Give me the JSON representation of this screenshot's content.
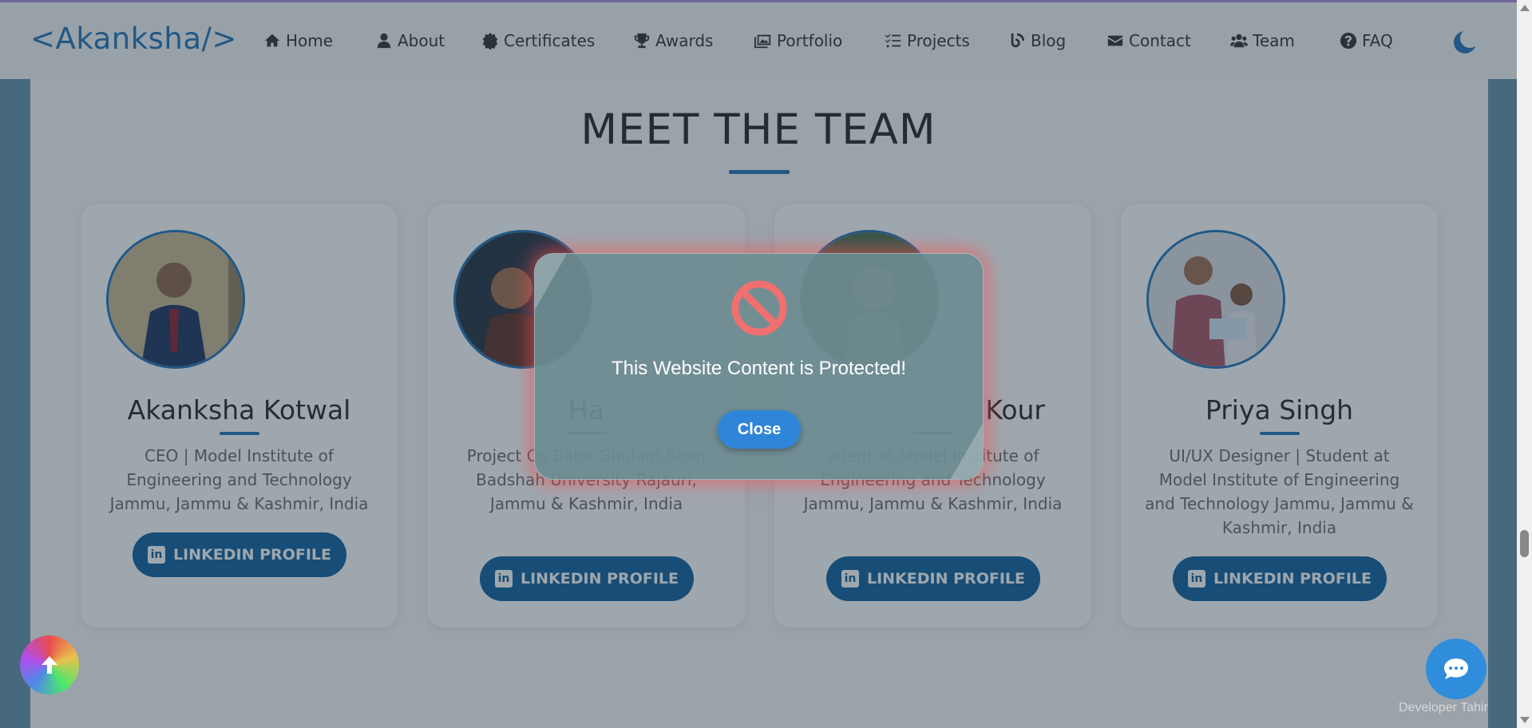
{
  "brand": {
    "logo": "<Akanksha/>"
  },
  "nav": {
    "items": [
      {
        "label": "Home",
        "icon": "home-icon"
      },
      {
        "label": "About",
        "icon": "user-icon"
      },
      {
        "label": "Certificates",
        "icon": "certificate-icon"
      },
      {
        "label": "Awards",
        "icon": "trophy-icon"
      },
      {
        "label": "Portfolio",
        "icon": "images-icon"
      },
      {
        "label": "Projects",
        "icon": "list-check-icon"
      },
      {
        "label": "Blog",
        "icon": "blog-icon"
      },
      {
        "label": "Contact",
        "icon": "envelope-icon"
      },
      {
        "label": "Team",
        "icon": "users-icon"
      },
      {
        "label": "FAQ",
        "icon": "question-circle-icon"
      }
    ],
    "theme_toggle_icon": "moon-icon"
  },
  "section": {
    "title": "MEET THE TEAM"
  },
  "team": [
    {
      "name": "Akanksha Kotwal",
      "role": "CEO | Model Institute of Engineering and Technology Jammu, Jammu & Kashmir, India",
      "button": "LINKEDIN PROFILE"
    },
    {
      "name": "Ha",
      "role": "Project Co Baba Ghulam Shah Badshah University Rajauri, Jammu & Kashmir, India",
      "button": "LINKEDIN PROFILE"
    },
    {
      "name": "Kour",
      "role": "udent at Model Institute of Engineering and Technology Jammu, Jammu & Kashmir, India",
      "button": "LINKEDIN PROFILE"
    },
    {
      "name": "Priya Singh",
      "role": "UI/UX Designer | Student at Model Institute of Engineering and Technology Jammu, Jammu & Kashmir, India",
      "button": "LINKEDIN PROFILE"
    }
  ],
  "modal": {
    "icon": "prohibited-icon",
    "message": "This Website Content is Protected!",
    "close_label": "Close"
  },
  "footer": {
    "developer_credit": "Developer Tahir"
  },
  "floating": {
    "scroll_top_icon": "arrow-up-icon",
    "chat_icon": "chat-bubble-icon"
  },
  "colors": {
    "accent": "#1d6fb5",
    "linkedin": "#0a5b99",
    "modal_glow": "#ff5050",
    "close_button": "#2f86d8"
  }
}
